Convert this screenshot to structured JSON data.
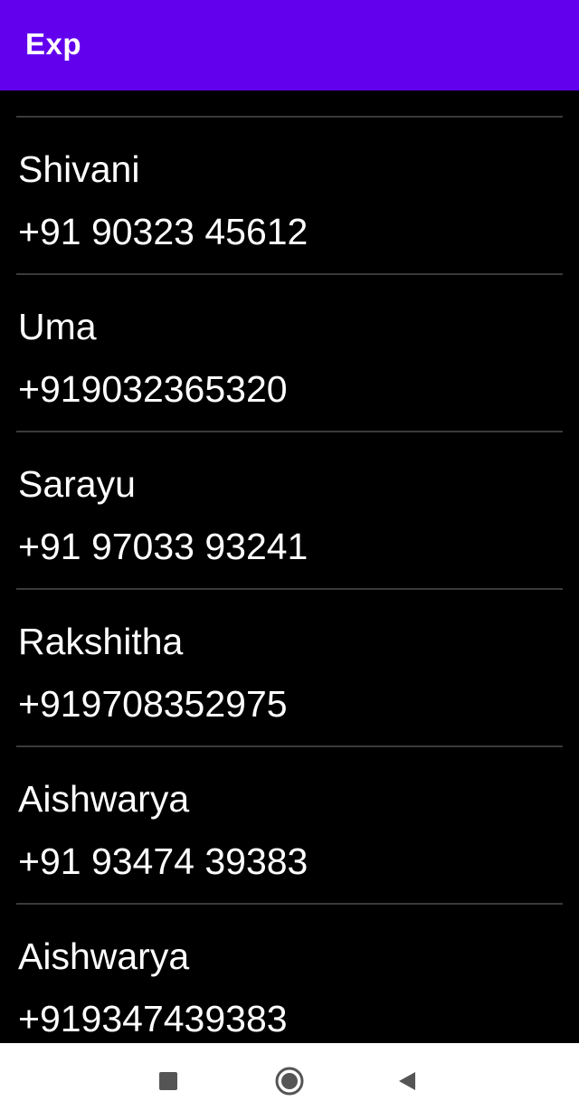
{
  "app_bar": {
    "title": "Exp",
    "color": "#6200EE"
  },
  "contacts": [
    {
      "name": "Shivani",
      "phone": "+91 90323 45612"
    },
    {
      "name": "Uma",
      "phone": "+919032365320"
    },
    {
      "name": "Sarayu",
      "phone": "+91 97033 93241"
    },
    {
      "name": "Rakshitha",
      "phone": "+919708352975"
    },
    {
      "name": "Aishwarya",
      "phone": "+91 93474 39383"
    },
    {
      "name": "Aishwarya",
      "phone": "+919347439383"
    }
  ],
  "nav_bar": {
    "recents": "square-icon",
    "home": "circle-home-icon",
    "back": "triangle-back-icon"
  }
}
